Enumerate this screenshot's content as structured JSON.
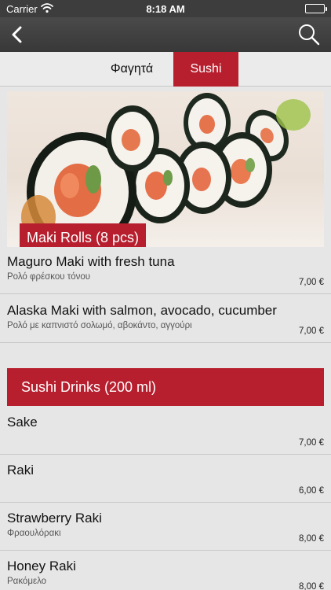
{
  "status_bar": {
    "carrier": "Carrier",
    "time": "8:18 AM"
  },
  "nav_bar": {
    "back_icon": "chevron-left-icon",
    "search_icon": "search-icon"
  },
  "tabs": [
    {
      "label": "Φαγητά",
      "selected": false
    },
    {
      "label": "Sushi",
      "selected": true
    }
  ],
  "colors": {
    "accent": "#b71f2e",
    "nav_background": "#3d3d3d",
    "content_background": "#e6e6e6"
  },
  "maki_section": {
    "title": "Maki Rolls (8 pcs)",
    "items": [
      {
        "name": "Maguro Maki with fresh tuna",
        "description": "Ρολό φρέσκου τόνου",
        "price": "7,00 €"
      },
      {
        "name": "Alaska Maki with salmon, avocado, cucumber",
        "description": "Ρολό με καπνιστό σολωμό, αβοκάντο, αγγούρι",
        "price": "7,00 €"
      }
    ]
  },
  "drinks_section": {
    "title": "Sushi Drinks (200 ml)",
    "items": [
      {
        "name": "Sake",
        "description": "",
        "price": "7,00 €"
      },
      {
        "name": "Raki",
        "description": "",
        "price": "6,00 €"
      },
      {
        "name": "Strawberry Raki",
        "description": "Φραουλόρακι",
        "price": "8,00 €"
      },
      {
        "name": "Honey Raki",
        "description": "Ρακόμελο",
        "price": "8,00 €"
      }
    ]
  }
}
